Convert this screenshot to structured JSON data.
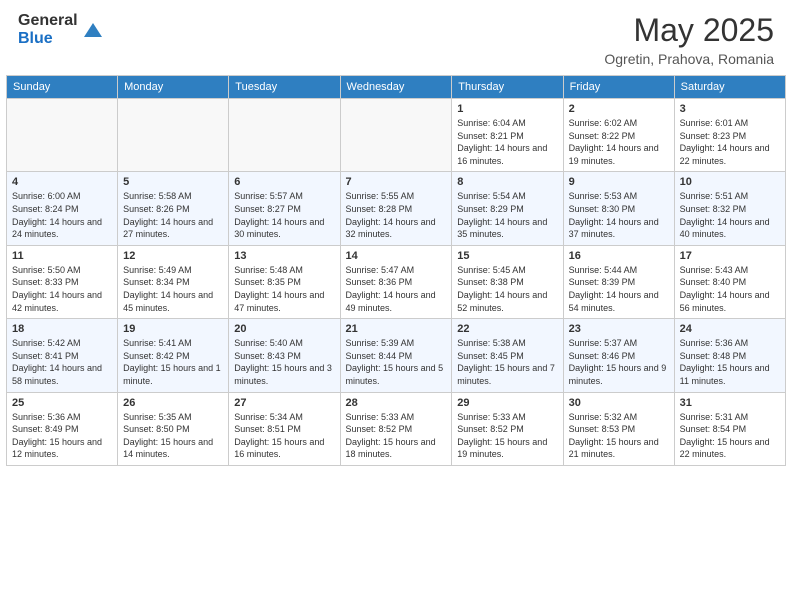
{
  "header": {
    "logo_general": "General",
    "logo_blue": "Blue",
    "month_year": "May 2025",
    "location": "Ogretin, Prahova, Romania"
  },
  "days_of_week": [
    "Sunday",
    "Monday",
    "Tuesday",
    "Wednesday",
    "Thursday",
    "Friday",
    "Saturday"
  ],
  "weeks": [
    [
      {
        "day": "",
        "sunrise": "",
        "sunset": "",
        "daylight": ""
      },
      {
        "day": "",
        "sunrise": "",
        "sunset": "",
        "daylight": ""
      },
      {
        "day": "",
        "sunrise": "",
        "sunset": "",
        "daylight": ""
      },
      {
        "day": "",
        "sunrise": "",
        "sunset": "",
        "daylight": ""
      },
      {
        "day": "1",
        "sunrise": "Sunrise: 6:04 AM",
        "sunset": "Sunset: 8:21 PM",
        "daylight": "Daylight: 14 hours and 16 minutes."
      },
      {
        "day": "2",
        "sunrise": "Sunrise: 6:02 AM",
        "sunset": "Sunset: 8:22 PM",
        "daylight": "Daylight: 14 hours and 19 minutes."
      },
      {
        "day": "3",
        "sunrise": "Sunrise: 6:01 AM",
        "sunset": "Sunset: 8:23 PM",
        "daylight": "Daylight: 14 hours and 22 minutes."
      }
    ],
    [
      {
        "day": "4",
        "sunrise": "Sunrise: 6:00 AM",
        "sunset": "Sunset: 8:24 PM",
        "daylight": "Daylight: 14 hours and 24 minutes."
      },
      {
        "day": "5",
        "sunrise": "Sunrise: 5:58 AM",
        "sunset": "Sunset: 8:26 PM",
        "daylight": "Daylight: 14 hours and 27 minutes."
      },
      {
        "day": "6",
        "sunrise": "Sunrise: 5:57 AM",
        "sunset": "Sunset: 8:27 PM",
        "daylight": "Daylight: 14 hours and 30 minutes."
      },
      {
        "day": "7",
        "sunrise": "Sunrise: 5:55 AM",
        "sunset": "Sunset: 8:28 PM",
        "daylight": "Daylight: 14 hours and 32 minutes."
      },
      {
        "day": "8",
        "sunrise": "Sunrise: 5:54 AM",
        "sunset": "Sunset: 8:29 PM",
        "daylight": "Daylight: 14 hours and 35 minutes."
      },
      {
        "day": "9",
        "sunrise": "Sunrise: 5:53 AM",
        "sunset": "Sunset: 8:30 PM",
        "daylight": "Daylight: 14 hours and 37 minutes."
      },
      {
        "day": "10",
        "sunrise": "Sunrise: 5:51 AM",
        "sunset": "Sunset: 8:32 PM",
        "daylight": "Daylight: 14 hours and 40 minutes."
      }
    ],
    [
      {
        "day": "11",
        "sunrise": "Sunrise: 5:50 AM",
        "sunset": "Sunset: 8:33 PM",
        "daylight": "Daylight: 14 hours and 42 minutes."
      },
      {
        "day": "12",
        "sunrise": "Sunrise: 5:49 AM",
        "sunset": "Sunset: 8:34 PM",
        "daylight": "Daylight: 14 hours and 45 minutes."
      },
      {
        "day": "13",
        "sunrise": "Sunrise: 5:48 AM",
        "sunset": "Sunset: 8:35 PM",
        "daylight": "Daylight: 14 hours and 47 minutes."
      },
      {
        "day": "14",
        "sunrise": "Sunrise: 5:47 AM",
        "sunset": "Sunset: 8:36 PM",
        "daylight": "Daylight: 14 hours and 49 minutes."
      },
      {
        "day": "15",
        "sunrise": "Sunrise: 5:45 AM",
        "sunset": "Sunset: 8:38 PM",
        "daylight": "Daylight: 14 hours and 52 minutes."
      },
      {
        "day": "16",
        "sunrise": "Sunrise: 5:44 AM",
        "sunset": "Sunset: 8:39 PM",
        "daylight": "Daylight: 14 hours and 54 minutes."
      },
      {
        "day": "17",
        "sunrise": "Sunrise: 5:43 AM",
        "sunset": "Sunset: 8:40 PM",
        "daylight": "Daylight: 14 hours and 56 minutes."
      }
    ],
    [
      {
        "day": "18",
        "sunrise": "Sunrise: 5:42 AM",
        "sunset": "Sunset: 8:41 PM",
        "daylight": "Daylight: 14 hours and 58 minutes."
      },
      {
        "day": "19",
        "sunrise": "Sunrise: 5:41 AM",
        "sunset": "Sunset: 8:42 PM",
        "daylight": "Daylight: 15 hours and 1 minute."
      },
      {
        "day": "20",
        "sunrise": "Sunrise: 5:40 AM",
        "sunset": "Sunset: 8:43 PM",
        "daylight": "Daylight: 15 hours and 3 minutes."
      },
      {
        "day": "21",
        "sunrise": "Sunrise: 5:39 AM",
        "sunset": "Sunset: 8:44 PM",
        "daylight": "Daylight: 15 hours and 5 minutes."
      },
      {
        "day": "22",
        "sunrise": "Sunrise: 5:38 AM",
        "sunset": "Sunset: 8:45 PM",
        "daylight": "Daylight: 15 hours and 7 minutes."
      },
      {
        "day": "23",
        "sunrise": "Sunrise: 5:37 AM",
        "sunset": "Sunset: 8:46 PM",
        "daylight": "Daylight: 15 hours and 9 minutes."
      },
      {
        "day": "24",
        "sunrise": "Sunrise: 5:36 AM",
        "sunset": "Sunset: 8:48 PM",
        "daylight": "Daylight: 15 hours and 11 minutes."
      }
    ],
    [
      {
        "day": "25",
        "sunrise": "Sunrise: 5:36 AM",
        "sunset": "Sunset: 8:49 PM",
        "daylight": "Daylight: 15 hours and 12 minutes."
      },
      {
        "day": "26",
        "sunrise": "Sunrise: 5:35 AM",
        "sunset": "Sunset: 8:50 PM",
        "daylight": "Daylight: 15 hours and 14 minutes."
      },
      {
        "day": "27",
        "sunrise": "Sunrise: 5:34 AM",
        "sunset": "Sunset: 8:51 PM",
        "daylight": "Daylight: 15 hours and 16 minutes."
      },
      {
        "day": "28",
        "sunrise": "Sunrise: 5:33 AM",
        "sunset": "Sunset: 8:52 PM",
        "daylight": "Daylight: 15 hours and 18 minutes."
      },
      {
        "day": "29",
        "sunrise": "Sunrise: 5:33 AM",
        "sunset": "Sunset: 8:52 PM",
        "daylight": "Daylight: 15 hours and 19 minutes."
      },
      {
        "day": "30",
        "sunrise": "Sunrise: 5:32 AM",
        "sunset": "Sunset: 8:53 PM",
        "daylight": "Daylight: 15 hours and 21 minutes."
      },
      {
        "day": "31",
        "sunrise": "Sunrise: 5:31 AM",
        "sunset": "Sunset: 8:54 PM",
        "daylight": "Daylight: 15 hours and 22 minutes."
      }
    ]
  ]
}
